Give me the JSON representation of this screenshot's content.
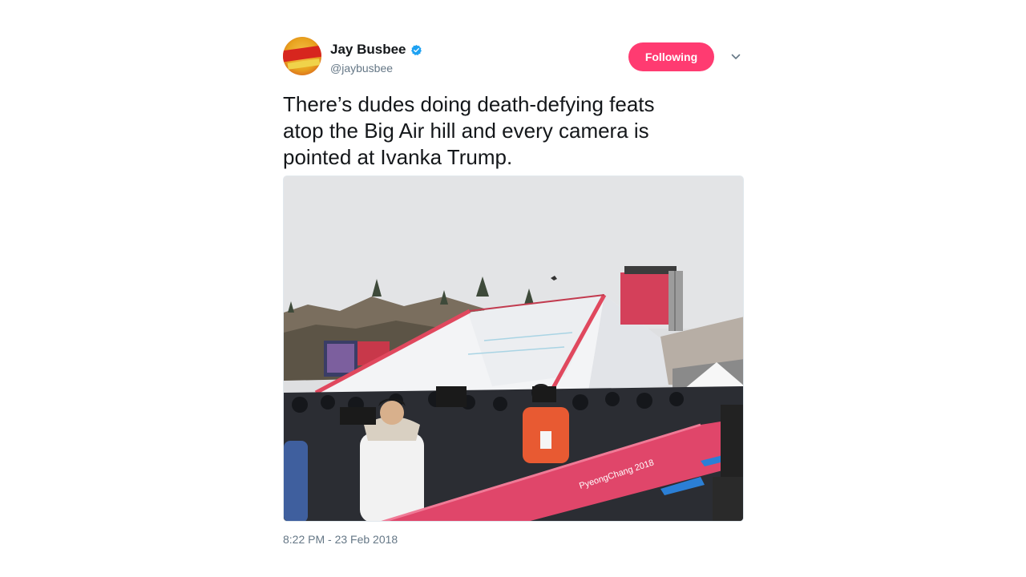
{
  "tweet": {
    "author": {
      "name": "Jay Busbee",
      "handle": "@jaybusbee",
      "verified": true,
      "avatar_icon": "profile-avatar"
    },
    "follow_label": "Following",
    "menu_icon": "chevron-down-icon",
    "text": "There’s dudes doing death-defying feats\natop the Big Air hill and every camera is\npointed at Ivanka Trump.",
    "media": {
      "type": "photo",
      "banner_text": "PyeongChang 2018"
    },
    "timestamp": "8:22 PM - 23 Feb 2018"
  },
  "colors": {
    "follow_button": "#ff3b71",
    "verified_badge": "#1da1f2",
    "text_primary": "#14171a",
    "text_secondary": "#657786"
  }
}
